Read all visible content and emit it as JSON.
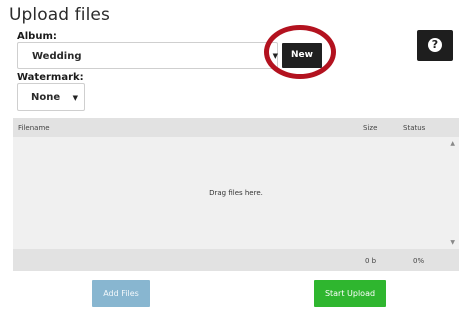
{
  "page": {
    "title": "Upload files"
  },
  "album": {
    "label": "Album:",
    "selected": "Wedding",
    "new_button": "New"
  },
  "watermark": {
    "label": "Watermark:",
    "selected": "None"
  },
  "help": {
    "icon": "question-mark-icon",
    "glyph": "?"
  },
  "file_table": {
    "columns": [
      "Filename",
      "Size",
      "Status"
    ],
    "drop_text": "Drag files here.",
    "footer": {
      "total_size": "0 b",
      "progress": "0%"
    }
  },
  "actions": {
    "add_files": "Add Files",
    "start_upload": "Start Upload"
  },
  "colors": {
    "add_files_bg": "#88b6d0",
    "start_upload_bg": "#2fb62f",
    "highlight_circle": "#b3121f",
    "dark_button": "#202020"
  }
}
